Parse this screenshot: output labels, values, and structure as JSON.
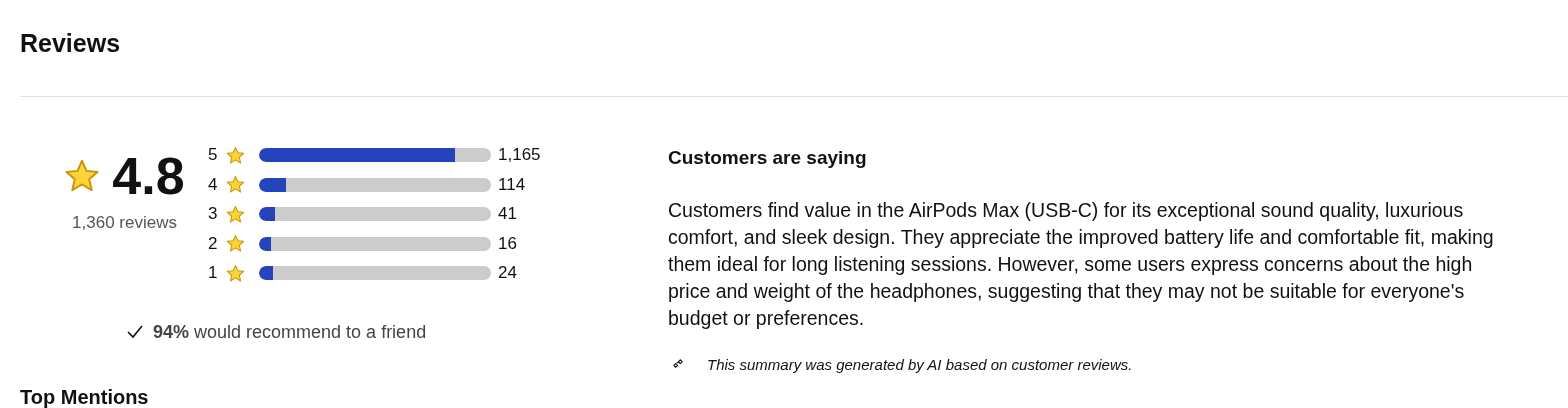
{
  "title": "Reviews",
  "rating": {
    "value": "4.8",
    "count": "1,360 reviews"
  },
  "distribution": [
    {
      "stars_label": "5",
      "level": 0.845,
      "count": "1,165"
    },
    {
      "stars_label": "4",
      "level": 0.116,
      "count": "114"
    },
    {
      "stars_label": "3",
      "level": 0.07,
      "count": "41"
    },
    {
      "stars_label": "2",
      "level": 0.05,
      "count": "16"
    },
    {
      "stars_label": "1",
      "level": 0.06,
      "count": "24"
    }
  ],
  "recommend": "**94%** would recommend to a friend",
  "summary": {
    "heading": "Customers are saying",
    "text": "Customers find value in the AirPods Max (USB-C) for its exceptional sound quality, luxurious comfort, and sleek design. They appreciate the improved battery life and comfortable fit, making them ideal for long listening sessions. However, some users express concerns about the high price and weight of the headphones, suggesting that they may not be suitable for everyone's budget or preferences.",
    "note": "This summary was generated by AI based on customer reviews."
  },
  "next_section": "Top Mentions"
}
